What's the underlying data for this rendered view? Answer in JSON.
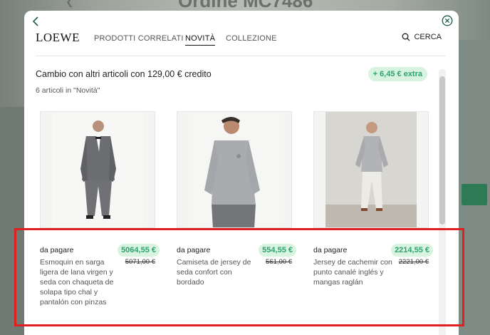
{
  "background": {
    "title_fragment": "Ordine MC7486"
  },
  "nav": {
    "logo": "LOEWE",
    "tabs": [
      {
        "label": "PRODOTTI CORRELATI"
      },
      {
        "label": "NOVITÀ"
      },
      {
        "label": "COLLEZIONE"
      }
    ],
    "search_label": "CERCA"
  },
  "exchange": {
    "title": "Cambio con altri articoli con 129,00 € credito",
    "extra_badge": "+ 6,45 € extra",
    "count_text": "6 articoli in \"Novità\""
  },
  "products": [
    {
      "pay_label": "da pagare",
      "price": "5064,55 €",
      "old_price": "5071,00 €",
      "description": "Esmoquin en sarga ligera de lana virgen y seda con chaqueta de solapa tipo chal y pantalón con pinzas"
    },
    {
      "pay_label": "da pagare",
      "price": "554,55 €",
      "old_price": "561,00 €",
      "description": "Camiseta de jersey de seda confort con bordado"
    },
    {
      "pay_label": "da pagare",
      "price": "2214,55 €",
      "old_price": "2221,00 €",
      "description": "Jersey de cachemir con punto canalé inglés y mangas raglán"
    }
  ],
  "colors": {
    "accent_green": "#2fa36b",
    "pill_bg": "#d8f3df",
    "icon_green": "#1c5e45",
    "highlight_red": "#e02020"
  },
  "icons": [
    "back-icon",
    "close-icon",
    "search-icon"
  ]
}
